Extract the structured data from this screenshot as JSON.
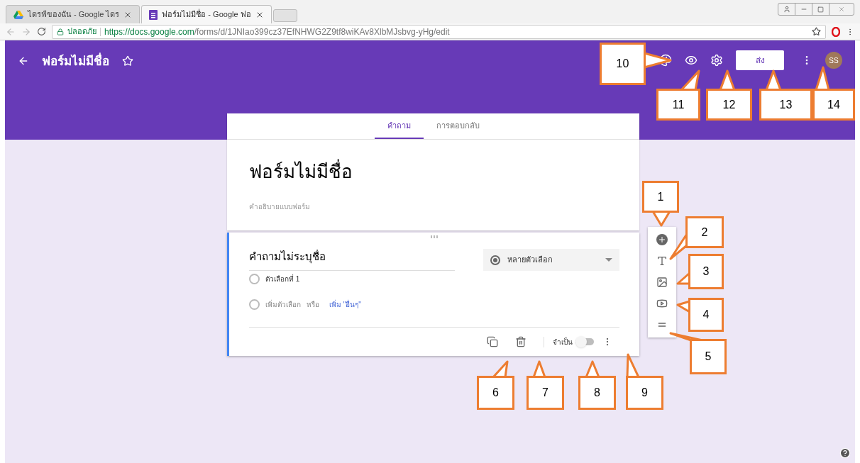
{
  "browser": {
    "tabs": [
      {
        "title": "ไดรฟ์ของฉัน - Google ไดร",
        "selected": false,
        "kind": "drive"
      },
      {
        "title": "ฟอร์มไม่มีชื่อ - Google ฟอ",
        "selected": true,
        "kind": "forms"
      }
    ],
    "secure_label": "ปลอดภัย",
    "url_host": "https://docs.google.com",
    "url_path": "/forms/d/1JNIao399cz37EfNHWG2Z9tf8wiKAv8XlbMJsbvg-yHg/edit"
  },
  "header": {
    "title": "ฟอร์มไม่มีชื่อ",
    "send_label": "ส่ง",
    "avatar": "SS"
  },
  "tabs": [
    {
      "label": "คำถาม",
      "selected": true
    },
    {
      "label": "การตอบกลับ",
      "selected": false
    }
  ],
  "form": {
    "title": "ฟอร์มไม่มีชื่อ",
    "description_placeholder": "คำอธิบายแบบฟอร์ม"
  },
  "question": {
    "title": "คำถามไม่ระบุชื่อ",
    "type": "หลายตัวเลือก",
    "options": [
      {
        "label": "ตัวเลือกที่ 1",
        "selected": false
      }
    ],
    "add_option": "เพิ่มตัวเลือก",
    "add_option_selected": false,
    "or": "หรือ",
    "add_other": "เพิ่ม \"อื่นๆ\"",
    "required_label": "จำเป็น",
    "required": false
  },
  "callouts": [
    "1",
    "2",
    "3",
    "4",
    "5",
    "6",
    "7",
    "8",
    "9",
    "10",
    "11",
    "12",
    "13",
    "14"
  ]
}
